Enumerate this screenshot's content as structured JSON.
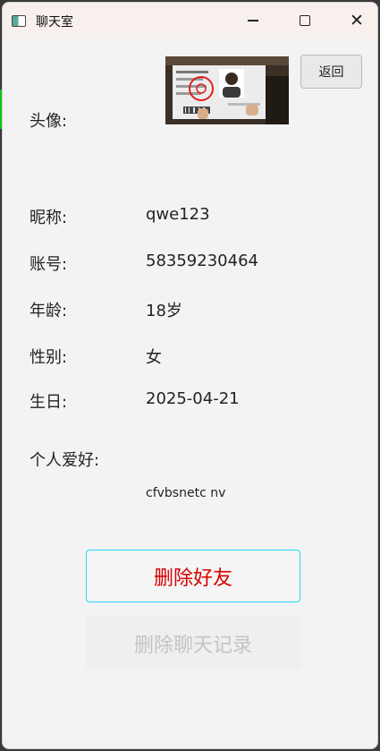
{
  "window": {
    "title": "聊天室"
  },
  "header": {
    "back_label": "返回"
  },
  "profile": {
    "avatar_label": "头像:",
    "nickname_label": "昵称:",
    "nickname": "qwe123",
    "account_label": "账号:",
    "account": "58359230464",
    "age_label": "年龄:",
    "age": "18岁",
    "gender_label": "性别:",
    "gender": "女",
    "birthday_label": "生日:",
    "birthday": "2025-04-21",
    "hobby_label": "个人爱好:",
    "hobby": "cfvbsnetc nv"
  },
  "actions": {
    "delete_friend_label": "删除好友",
    "delete_history_label": "删除聊天记录"
  },
  "colors": {
    "title_bar": "#f8f0ed",
    "background": "#f3f3f3",
    "delete_friend_text": "#d90000",
    "delete_friend_border": "#24d6ff",
    "disabled_text": "#c4c4c4"
  }
}
